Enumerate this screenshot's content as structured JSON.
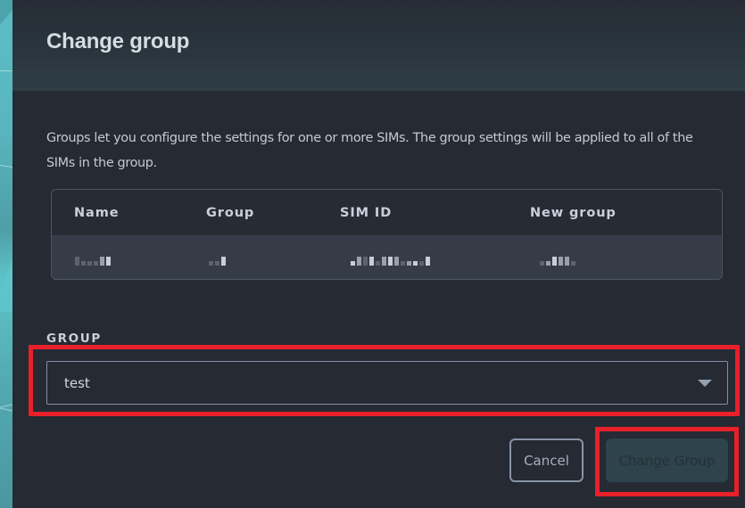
{
  "modal": {
    "title": "Change group",
    "description": "Groups let you configure the settings for one or more SIMs. The group settings will be applied to all of the SIMs in the group."
  },
  "table": {
    "columns": [
      "Name",
      "Group",
      "SIM ID",
      "New group"
    ],
    "rows": [
      {
        "name": "[redacted]",
        "group": "[redacted]",
        "sim_id": "[redacted]",
        "new_group": "[redacted]"
      }
    ]
  },
  "group_field": {
    "label": "GROUP",
    "selected_value": "test",
    "icon": "caret-down-icon"
  },
  "buttons": {
    "cancel_label": "Cancel",
    "submit_label": "Change Group",
    "submit_disabled": true
  },
  "colors": {
    "background": "#252a33",
    "accent_teal": "#5dbcc4",
    "highlight": "#e8202a",
    "disabled_button": "#2e434b"
  }
}
